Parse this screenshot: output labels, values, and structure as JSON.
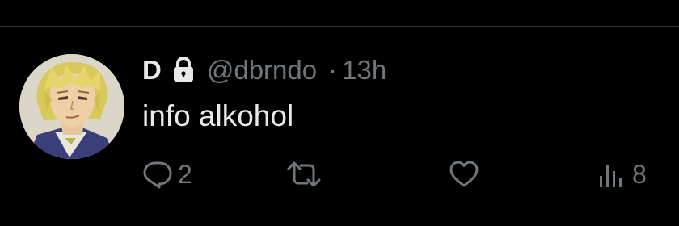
{
  "tweet": {
    "author": {
      "display_name": "D",
      "handle": "@dbrndo",
      "protected": true,
      "avatar": "blonde-anime-character-avatar"
    },
    "separator": "·",
    "timestamp": "13h",
    "text": "info alkohol",
    "actions": {
      "reply": {
        "icon": "reply-icon",
        "count": "2"
      },
      "retweet": {
        "icon": "retweet-icon",
        "count": ""
      },
      "like": {
        "icon": "heart-icon",
        "count": ""
      },
      "views": {
        "icon": "views-icon",
        "count": "8"
      }
    }
  },
  "colors": {
    "background": "#000000",
    "primary_text": "#e7e9ea",
    "secondary_text": "#71767b",
    "divider": "#2f3336"
  }
}
